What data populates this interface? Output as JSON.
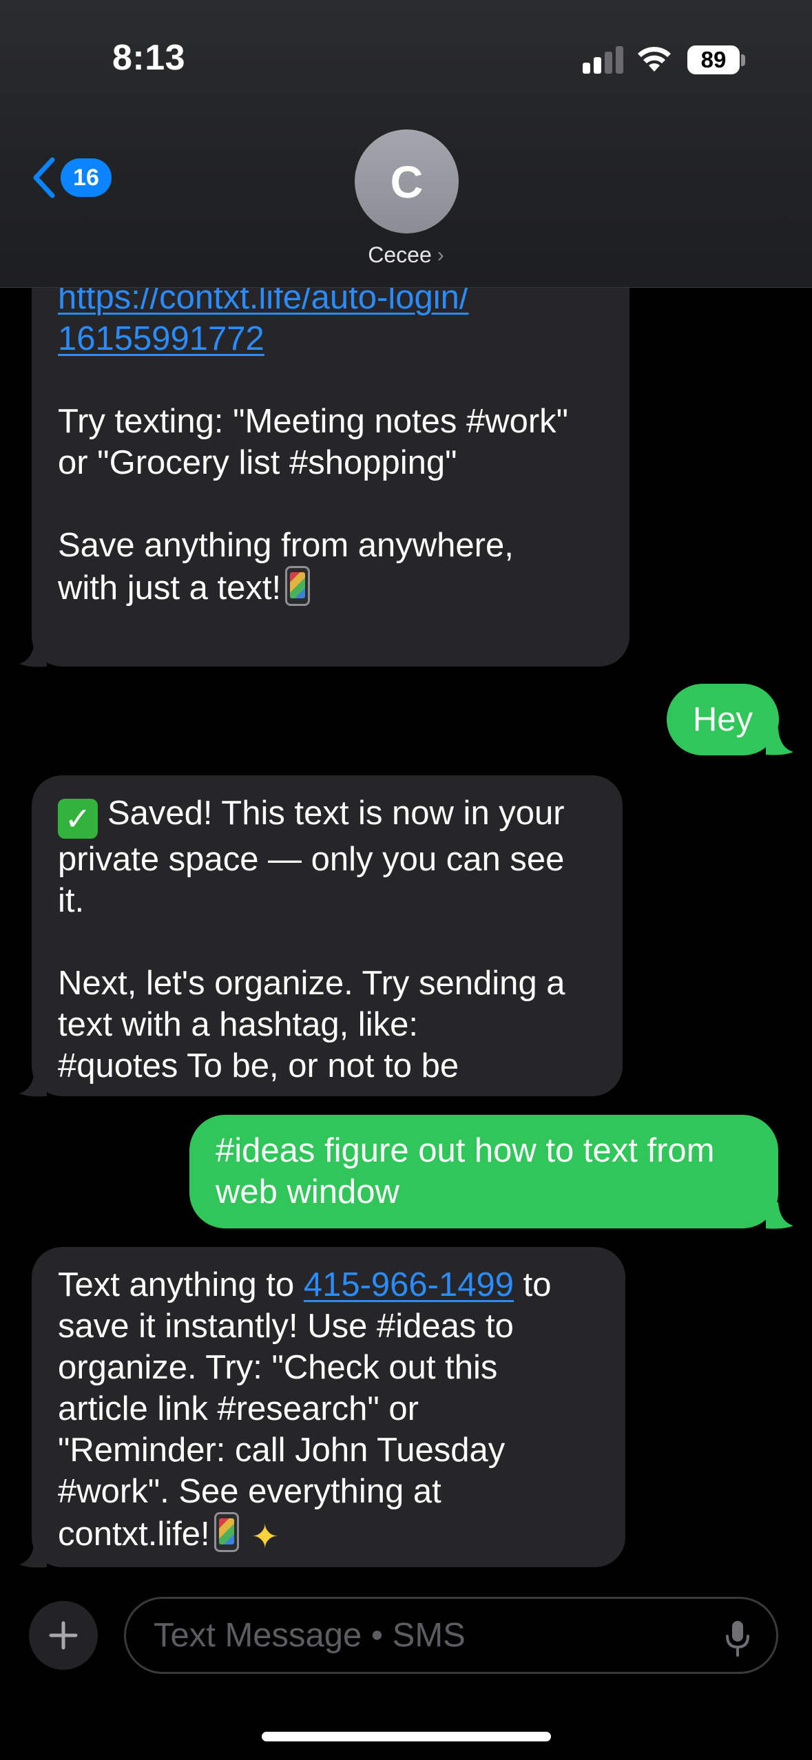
{
  "status_bar": {
    "time": "8:13",
    "battery": "89"
  },
  "header": {
    "back_badge": "16",
    "avatar_initial": "C",
    "contact_name": "Cecee"
  },
  "messages": [
    {
      "direction": "incoming",
      "link_line1": "https://contxt.life/auto-login/",
      "link_line2": "16155991772",
      "para2": "Try texting: \"Meeting notes #work\"\nor \"Grocery list #shopping\"",
      "para3": "Save anything from anywhere,\nwith just a text!"
    },
    {
      "direction": "outgoing",
      "text": "Hey"
    },
    {
      "direction": "incoming",
      "para1": "Saved! This text is now in your\nprivate space — only you can see\nit.",
      "para2": "Next, let's organize. Try sending a\ntext with a hashtag, like:\n#quotes To be, or not to be"
    },
    {
      "direction": "outgoing",
      "text": "#ideas figure out how to text from\nweb window"
    },
    {
      "direction": "incoming",
      "prefix": "Text anything to ",
      "phone": "415-966-1499",
      "suffix": " to\nsave it instantly! Use #ideas to\norganize. Try: \"Check out this\narticle link #research\" or\n\"Reminder: call John Tuesday\n#work\". See everything at\ncontxt.life!"
    }
  ],
  "input": {
    "placeholder": "Text Message • SMS"
  },
  "icons": {
    "back": "chevron-left-icon",
    "plus": "plus-icon",
    "mic": "microphone-icon",
    "signal": "cellular-signal-icon",
    "wifi": "wifi-icon",
    "battery": "battery-icon"
  },
  "colors": {
    "incoming_bubble": "#262628",
    "outgoing_bubble": "#30c659",
    "link": "#2a8cff",
    "accent": "#0a84ff"
  }
}
